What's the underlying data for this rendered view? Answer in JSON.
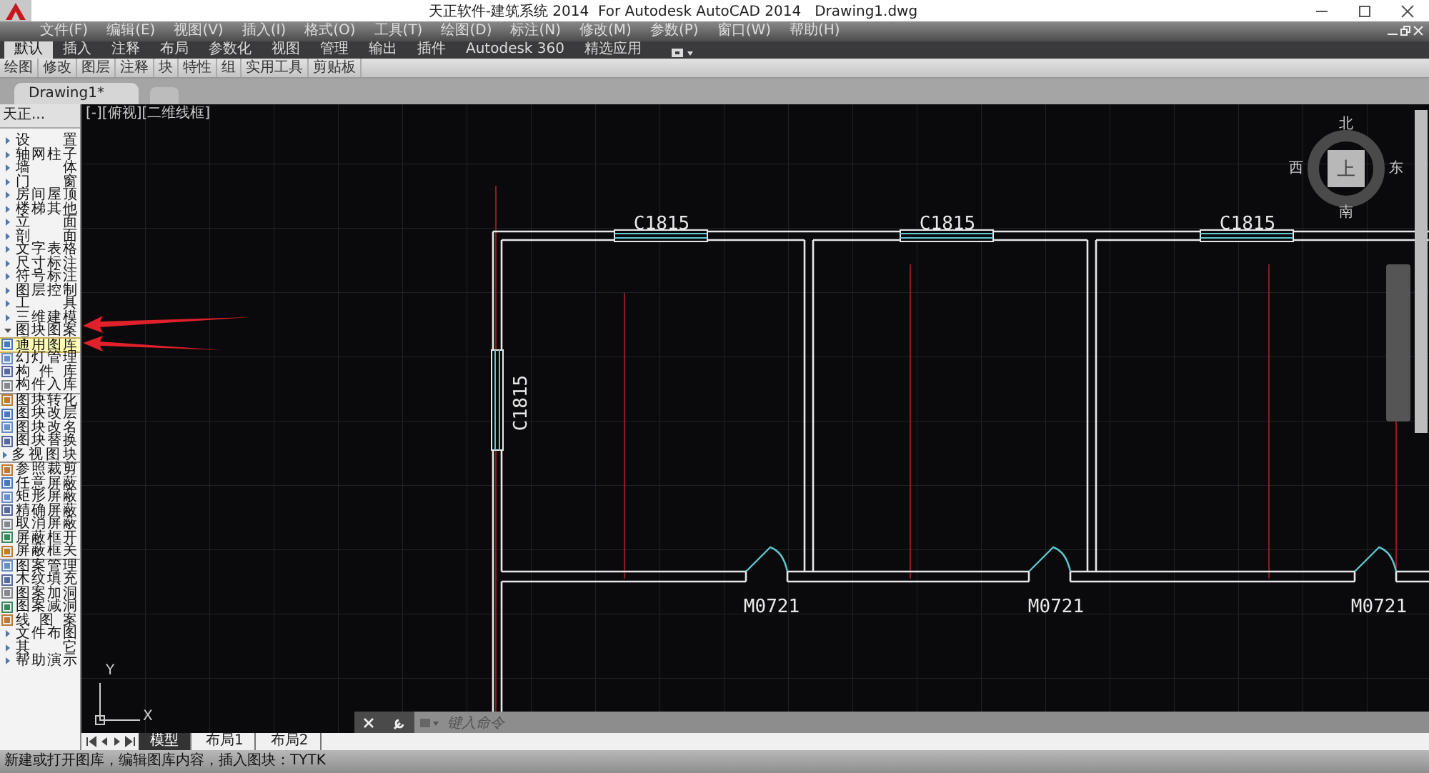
{
  "window": {
    "title": "天正软件-建筑系统 2014  For Autodesk AutoCAD 2014   Drawing1.dwg"
  },
  "menu_bar": [
    "文件(F)",
    "编辑(E)",
    "视图(V)",
    "插入(I)",
    "格式(O)",
    "工具(T)",
    "绘图(D)",
    "标注(N)",
    "修改(M)",
    "参数(P)",
    "窗口(W)",
    "帮助(H)"
  ],
  "ribbon_tabs": [
    {
      "label": "默认",
      "selected": true
    },
    {
      "label": "插入",
      "selected": false
    },
    {
      "label": "注释",
      "selected": false
    },
    {
      "label": "布局",
      "selected": false
    },
    {
      "label": "参数化",
      "selected": false
    },
    {
      "label": "视图",
      "selected": false
    },
    {
      "label": "管理",
      "selected": false
    },
    {
      "label": "输出",
      "selected": false
    },
    {
      "label": "插件",
      "selected": false
    },
    {
      "label": "Autodesk 360",
      "selected": false
    },
    {
      "label": "精选应用",
      "selected": false
    }
  ],
  "ribbon_panels": [
    "绘图",
    "修改",
    "图层",
    "注释",
    "块",
    "特性",
    "组",
    "实用工具",
    "剪贴板"
  ],
  "document_tabs": [
    {
      "label": "Drawing1*",
      "selected": true
    }
  ],
  "sidebar": {
    "title": "天正...",
    "items": [
      {
        "label": "设 置",
        "kind": "folder",
        "expanded": false
      },
      {
        "label": "轴网柱子",
        "kind": "folder",
        "expanded": false
      },
      {
        "label": "墙 体",
        "kind": "folder",
        "expanded": false
      },
      {
        "label": "门 窗",
        "kind": "folder",
        "expanded": false
      },
      {
        "label": "房间屋顶",
        "kind": "folder",
        "expanded": false
      },
      {
        "label": "楼梯其他",
        "kind": "folder",
        "expanded": false
      },
      {
        "label": "立 面",
        "kind": "folder",
        "expanded": false
      },
      {
        "label": "剖 面",
        "kind": "folder",
        "expanded": false
      },
      {
        "label": "文字表格",
        "kind": "folder",
        "expanded": false
      },
      {
        "label": "尺寸标注",
        "kind": "folder",
        "expanded": false
      },
      {
        "label": "符号标注",
        "kind": "folder",
        "expanded": false
      },
      {
        "label": "图层控制",
        "kind": "folder",
        "expanded": false
      },
      {
        "label": "工 具",
        "kind": "folder",
        "expanded": false
      },
      {
        "label": "三维建模",
        "kind": "folder",
        "expanded": false
      },
      {
        "label": "图块图案",
        "kind": "folder",
        "expanded": true,
        "children": [
          {
            "label": "通用图库",
            "kind": "tool",
            "selected": true
          },
          {
            "label": "幻灯管理",
            "kind": "tool",
            "selected": false
          },
          {
            "label": "构 件 库",
            "kind": "tool",
            "selected": false
          },
          {
            "label": "构件入库",
            "kind": "tool",
            "selected": false
          },
          {
            "kind": "separator"
          },
          {
            "label": "图块转化",
            "kind": "tool",
            "selected": false
          },
          {
            "label": "图块改层",
            "kind": "tool",
            "selected": false
          },
          {
            "label": "图块改名",
            "kind": "tool",
            "selected": false
          },
          {
            "label": "图块替换",
            "kind": "tool",
            "selected": false
          },
          {
            "label": "多视图块",
            "kind": "folder",
            "expanded": false
          },
          {
            "kind": "separator"
          },
          {
            "label": "参照裁剪",
            "kind": "tool",
            "selected": false
          },
          {
            "label": "任意屏蔽",
            "kind": "tool",
            "selected": false
          },
          {
            "label": "矩形屏蔽",
            "kind": "tool",
            "selected": false
          },
          {
            "label": "精确屏蔽",
            "kind": "tool",
            "selected": false
          },
          {
            "label": "取消屏蔽",
            "kind": "tool",
            "selected": false
          },
          {
            "label": "屏蔽框开",
            "kind": "tool",
            "selected": false
          },
          {
            "label": "屏蔽框关",
            "kind": "tool",
            "selected": false
          },
          {
            "kind": "separator"
          },
          {
            "label": "图案管理",
            "kind": "tool",
            "selected": false
          },
          {
            "label": "木纹填充",
            "kind": "tool",
            "selected": false
          },
          {
            "label": "图案加洞",
            "kind": "tool",
            "selected": false
          },
          {
            "label": "图案减洞",
            "kind": "tool",
            "selected": false
          },
          {
            "label": "线 图 案",
            "kind": "tool",
            "selected": false
          }
        ]
      },
      {
        "label": "文件布图",
        "kind": "folder",
        "expanded": false
      },
      {
        "label": "其 它",
        "kind": "folder",
        "expanded": false
      },
      {
        "label": "帮助演示",
        "kind": "folder",
        "expanded": false
      }
    ]
  },
  "viewport": {
    "label": "[-][俯视][二维线框]",
    "compass": {
      "north": "北",
      "east": "东",
      "south": "南",
      "west": "西",
      "top": "上"
    },
    "plan_labels": [
      {
        "text": "C1815",
        "kind": "window"
      },
      {
        "text": "C1815",
        "kind": "window"
      },
      {
        "text": "C1815",
        "kind": "window"
      },
      {
        "text": "C1815",
        "kind": "window_vertical"
      },
      {
        "text": "M0721",
        "kind": "door"
      },
      {
        "text": "M0721",
        "kind": "door"
      },
      {
        "text": "M0721",
        "kind": "door"
      }
    ],
    "ucs": {
      "x": "X",
      "y": "Y"
    }
  },
  "layout_tabs": [
    {
      "label": "模型",
      "selected": true
    },
    {
      "label": "布局1",
      "selected": false
    },
    {
      "label": "布局2",
      "selected": false
    }
  ],
  "command_line": {
    "placeholder": "键入命令"
  },
  "status_bar": "新建或打开图库，编辑图库内容，插入图块：TYTK"
}
